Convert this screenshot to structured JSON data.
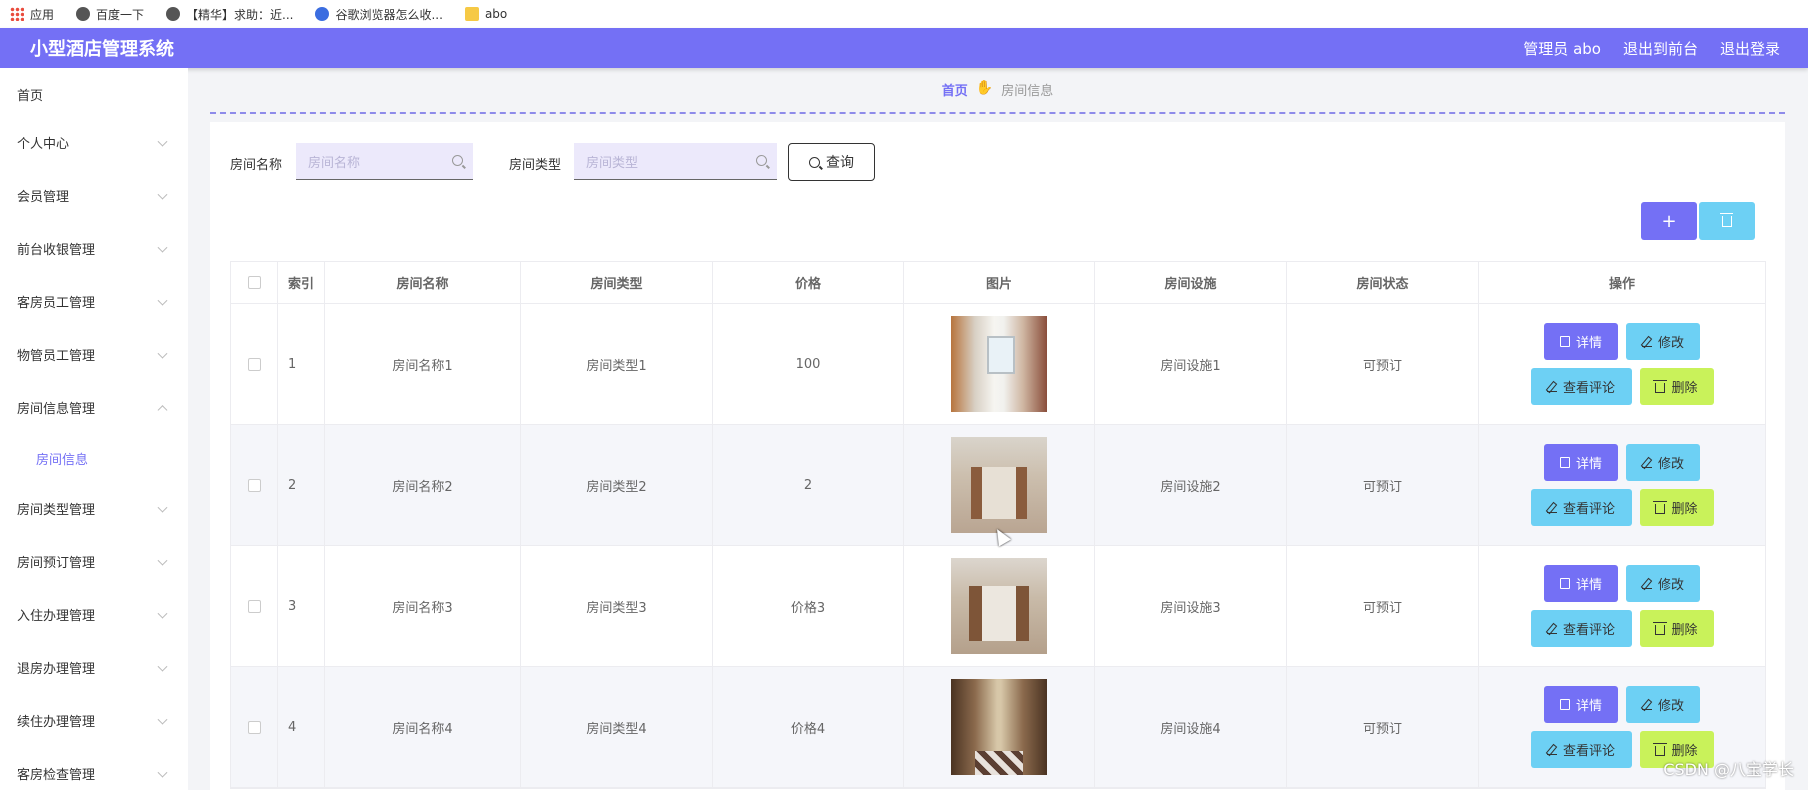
{
  "bookmarks": [
    {
      "label": "应用",
      "icon": "apps-grid-icon"
    },
    {
      "label": "百度一下",
      "icon": "globe-icon"
    },
    {
      "label": "【精华】求助：近...",
      "icon": "globe-icon"
    },
    {
      "label": "谷歌浏览器怎么收...",
      "icon": "baidu-paw-icon"
    },
    {
      "label": "abo",
      "icon": "folder-icon"
    }
  ],
  "header": {
    "title": "小型酒店管理系统",
    "admin": "管理员 abo",
    "to_front": "退出到前台",
    "logout": "退出登录"
  },
  "sidebar": {
    "items": [
      {
        "label": "首页"
      },
      {
        "label": "个人中心"
      },
      {
        "label": "会员管理"
      },
      {
        "label": "前台收银管理"
      },
      {
        "label": "客房员工管理"
      },
      {
        "label": "物管员工管理"
      },
      {
        "label": "房间信息管理"
      },
      {
        "label": "房间信息"
      },
      {
        "label": "房间类型管理"
      },
      {
        "label": "房间预订管理"
      },
      {
        "label": "入住办理管理"
      },
      {
        "label": "退房办理管理"
      },
      {
        "label": "续住办理管理"
      },
      {
        "label": "客房检查管理"
      }
    ]
  },
  "breadcrumb": {
    "home": "首页",
    "current": "房间信息"
  },
  "search": {
    "name_label": "房间名称",
    "name_placeholder": "房间名称",
    "type_label": "房间类型",
    "type_placeholder": "房间类型",
    "query_label": "查询"
  },
  "toolbar": {
    "add_label": "+"
  },
  "table": {
    "columns": [
      "索引",
      "房间名称",
      "房间类型",
      "价格",
      "图片",
      "房间设施",
      "房间状态",
      "操作"
    ],
    "rows": [
      {
        "index": "1",
        "name": "房间名称1",
        "type": "房间类型1",
        "price": "100",
        "facility": "房间设施1",
        "status": "可预订"
      },
      {
        "index": "2",
        "name": "房间名称2",
        "type": "房间类型2",
        "price": "2",
        "facility": "房间设施2",
        "status": "可预订"
      },
      {
        "index": "3",
        "name": "房间名称3",
        "type": "房间类型3",
        "price": "价格3",
        "facility": "房间设施3",
        "status": "可预订"
      },
      {
        "index": "4",
        "name": "房间名称4",
        "type": "房间类型4",
        "price": "价格4",
        "facility": "房间设施4",
        "status": "可预订"
      }
    ],
    "actions": {
      "detail": "详情",
      "edit": "修改",
      "review": "查看评论",
      "delete": "删除"
    }
  },
  "watermark": "CSDN @八宝学长",
  "colors": {
    "header_bg": "#7470f5",
    "accent": "#7470f5",
    "cyan": "#6dd0f4",
    "lime": "#c9f25a"
  }
}
